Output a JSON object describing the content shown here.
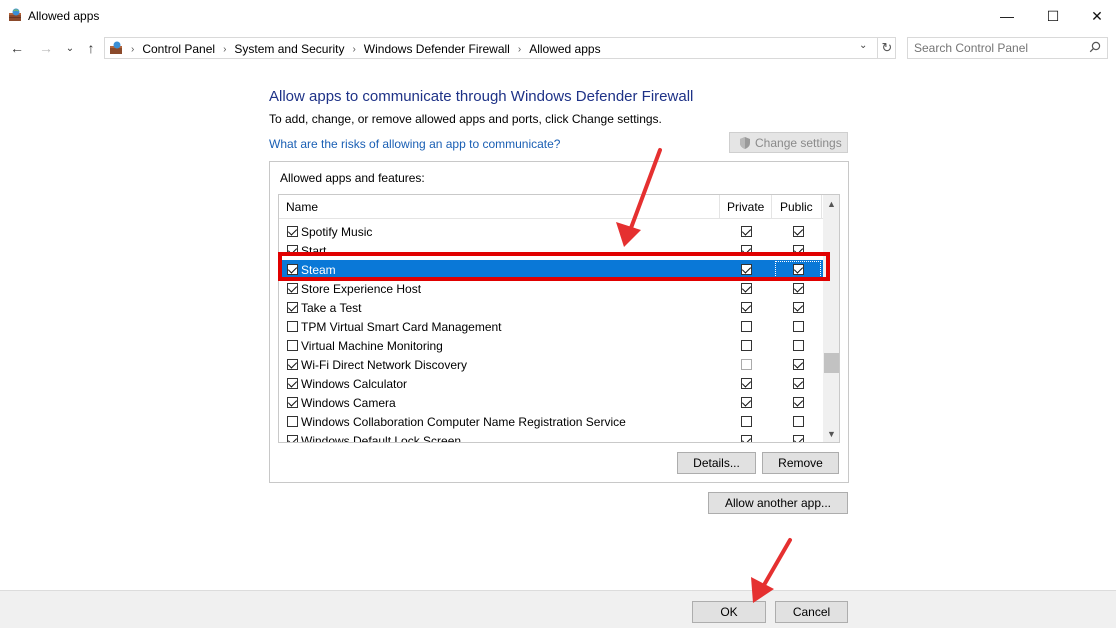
{
  "window": {
    "title": "Allowed apps",
    "minimize": "—",
    "maximize": "☐",
    "close": "✕"
  },
  "nav": {
    "back": "←",
    "forward": "→",
    "recent": "⌄",
    "up": "↑",
    "breadcrumbs": [
      "Control Panel",
      "System and Security",
      "Windows Defender Firewall",
      "Allowed apps"
    ],
    "refresh": "↻",
    "dropdown": "⌄"
  },
  "search": {
    "placeholder": "Search Control Panel"
  },
  "main": {
    "heading": "Allow apps to communicate through Windows Defender Firewall",
    "subtitle": "To add, change, or remove allowed apps and ports, click Change settings.",
    "risk_link": "What are the risks of allowing an app to communicate?",
    "change_settings": "Change settings",
    "group_label": "Allowed apps and features:",
    "columns": {
      "name": "Name",
      "private": "Private",
      "public": "Public"
    },
    "rows": [
      {
        "name": "Spotify Music",
        "enabled": true,
        "private": true,
        "public": true,
        "private_disabled": false
      },
      {
        "name": "Start",
        "enabled": true,
        "private": true,
        "public": true,
        "private_disabled": false
      },
      {
        "name": "Steam",
        "enabled": true,
        "private": true,
        "public": true,
        "private_disabled": false,
        "selected": true
      },
      {
        "name": "Store Experience Host",
        "enabled": true,
        "private": true,
        "public": true,
        "private_disabled": false
      },
      {
        "name": "Take a Test",
        "enabled": true,
        "private": true,
        "public": true,
        "private_disabled": false
      },
      {
        "name": "TPM Virtual Smart Card Management",
        "enabled": false,
        "private": false,
        "public": false,
        "private_disabled": false
      },
      {
        "name": "Virtual Machine Monitoring",
        "enabled": false,
        "private": false,
        "public": false,
        "private_disabled": false
      },
      {
        "name": "Wi-Fi Direct Network Discovery",
        "enabled": true,
        "private": false,
        "public": true,
        "private_disabled": true
      },
      {
        "name": "Windows Calculator",
        "enabled": true,
        "private": true,
        "public": true,
        "private_disabled": false
      },
      {
        "name": "Windows Camera",
        "enabled": true,
        "private": true,
        "public": true,
        "private_disabled": false
      },
      {
        "name": "Windows Collaboration Computer Name Registration Service",
        "enabled": false,
        "private": false,
        "public": false,
        "private_disabled": false
      },
      {
        "name": "Windows Default Lock Screen",
        "enabled": true,
        "private": true,
        "public": true,
        "private_disabled": false
      }
    ],
    "details": "Details...",
    "remove": "Remove",
    "allow_another": "Allow another app..."
  },
  "footer": {
    "ok": "OK",
    "cancel": "Cancel"
  },
  "colors": {
    "heading": "#1e3287",
    "link": "#1a5fb4",
    "selection": "#0a78d7",
    "annotation": "#e00000"
  },
  "icons": [
    "firewall-app-icon",
    "search-icon",
    "shield-icon",
    "scroll-up-icon",
    "scroll-down-icon"
  ]
}
